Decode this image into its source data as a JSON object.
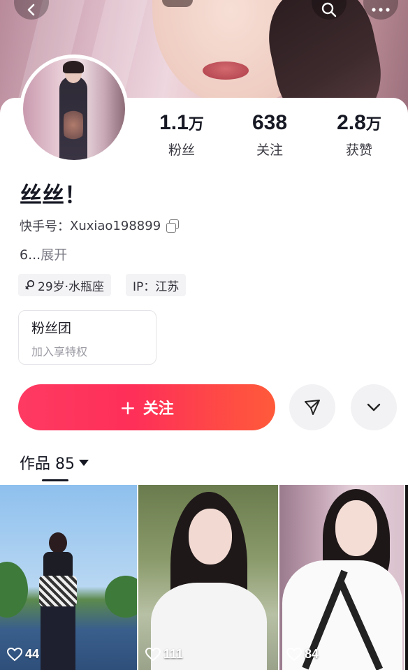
{
  "header": {
    "back_icon": "chevron-left-icon",
    "search_icon": "search-icon",
    "more_icon": "more-icon"
  },
  "profile": {
    "name": "丝丝！",
    "account_label": "快手号：",
    "account_id": "Xuxiao198899",
    "bio_text": "6...",
    "bio_expand": "展开",
    "tags": [
      "29岁·水瓶座",
      "IP：江苏"
    ]
  },
  "stats": [
    {
      "value": "1.1",
      "unit": "万",
      "label": "粉丝"
    },
    {
      "value": "638",
      "unit": "",
      "label": "关注"
    },
    {
      "value": "2.8",
      "unit": "万",
      "label": "获赞"
    }
  ],
  "fanclub": {
    "title": "粉丝团",
    "subtitle": "加入享特权"
  },
  "actions": {
    "follow_plus": "+",
    "follow_label": "关注",
    "share_icon": "send-icon",
    "dropdown_icon": "chevron-down-icon"
  },
  "works": {
    "tab_label": "作品 85",
    "videos": [
      {
        "likes": "44"
      },
      {
        "likes": "111"
      },
      {
        "likes": "84"
      }
    ]
  },
  "colors": {
    "follow_gradient_start": "#fe3a62",
    "follow_gradient_end": "#ff5a3a",
    "text_primary": "#161823"
  }
}
